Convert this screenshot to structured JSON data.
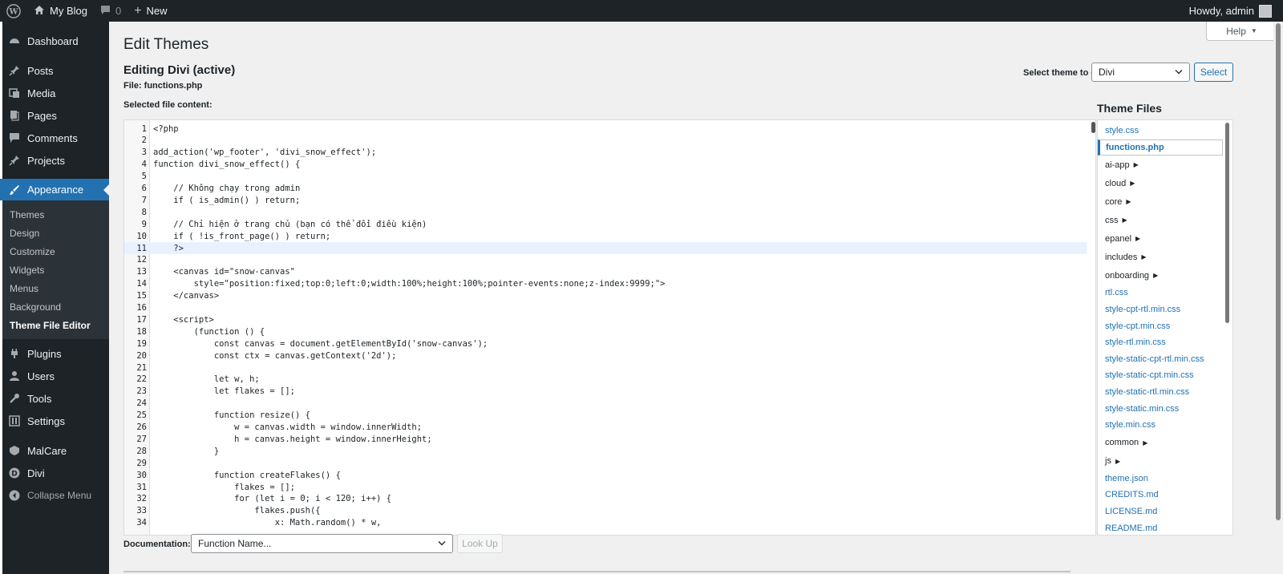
{
  "adminbar": {
    "site_name": "My Blog",
    "comments_count": "0",
    "new_label": "New",
    "howdy": "Howdy, admin"
  },
  "sidebar": {
    "items": [
      {
        "label": "Dashboard",
        "icon": "dashboard-icon"
      },
      {
        "label": "Posts",
        "icon": "pin-icon"
      },
      {
        "label": "Media",
        "icon": "media-icon"
      },
      {
        "label": "Pages",
        "icon": "page-icon"
      },
      {
        "label": "Comments",
        "icon": "comment-icon"
      },
      {
        "label": "Projects",
        "icon": "pin-icon"
      },
      {
        "label": "Appearance",
        "icon": "brush-icon"
      }
    ],
    "submenu": [
      "Themes",
      "Design",
      "Customize",
      "Widgets",
      "Menus",
      "Background",
      "Theme File Editor"
    ],
    "items2": [
      {
        "label": "Plugins",
        "icon": "plug-icon"
      },
      {
        "label": "Users",
        "icon": "user-icon"
      },
      {
        "label": "Tools",
        "icon": "wrench-icon"
      },
      {
        "label": "Settings",
        "icon": "settings-icon"
      },
      {
        "label": "MalCare",
        "icon": "malcare-icon"
      },
      {
        "label": "Divi",
        "icon": "divi-icon"
      }
    ],
    "collapse": "Collapse Menu"
  },
  "main": {
    "title": "Edit Themes",
    "help": "Help",
    "editing": "Editing Divi (active)",
    "file": "File: functions.php",
    "selected_content": "Selected file content:",
    "select_theme_label": "Select theme to edit:",
    "theme_selected": "Divi",
    "select_button": "Select",
    "theme_files_title": "Theme Files",
    "documentation_label": "Documentation:",
    "doc_placeholder": "Function Name...",
    "lookup_button": "Look Up"
  },
  "code_lines": [
    "<?php",
    "",
    "add_action('wp_footer', 'divi_snow_effect');",
    "function divi_snow_effect() {",
    "",
    "    // Không chạy trong admin",
    "    if ( is_admin() ) return;",
    "",
    "    // Chỉ hiện ở trang chủ (bạn có thể đổi điều kiện)",
    "    if ( !is_front_page() ) return;",
    "    ?>",
    "",
    "    <canvas id=\"snow-canvas\"",
    "        style=\"position:fixed;top:0;left:0;width:100%;height:100%;pointer-events:none;z-index:9999;\">",
    "    </canvas>",
    "",
    "    <script>",
    "        (function () {",
    "            const canvas = document.getElementById('snow-canvas');",
    "            const ctx = canvas.getContext('2d');",
    "",
    "            let w, h;",
    "            let flakes = [];",
    "",
    "            function resize() {",
    "                w = canvas.width = window.innerWidth;",
    "                h = canvas.height = window.innerHeight;",
    "            }",
    "",
    "            function createFlakes() {",
    "                flakes = [];",
    "                for (let i = 0; i < 120; i++) {",
    "                    flakes.push({",
    "                        x: Math.random() * w,"
  ],
  "active_line": 11,
  "theme_files": [
    {
      "name": "style.css",
      "type": "file"
    },
    {
      "name": "functions.php",
      "type": "file",
      "active": true
    },
    {
      "name": "ai-app",
      "type": "folder"
    },
    {
      "name": "cloud",
      "type": "folder"
    },
    {
      "name": "core",
      "type": "folder"
    },
    {
      "name": "css",
      "type": "folder"
    },
    {
      "name": "epanel",
      "type": "folder"
    },
    {
      "name": "includes",
      "type": "folder"
    },
    {
      "name": "onboarding",
      "type": "folder"
    },
    {
      "name": "rtl.css",
      "type": "file"
    },
    {
      "name": "style-cpt-rtl.min.css",
      "type": "file"
    },
    {
      "name": "style-cpt.min.css",
      "type": "file"
    },
    {
      "name": "style-rtl.min.css",
      "type": "file"
    },
    {
      "name": "style-static-cpt-rtl.min.css",
      "type": "file"
    },
    {
      "name": "style-static-cpt.min.css",
      "type": "file"
    },
    {
      "name": "style-static-rtl.min.css",
      "type": "file"
    },
    {
      "name": "style-static.min.css",
      "type": "file"
    },
    {
      "name": "style.min.css",
      "type": "file"
    },
    {
      "name": "common",
      "type": "folder"
    },
    {
      "name": "js",
      "type": "folder"
    },
    {
      "name": "theme.json",
      "type": "file"
    },
    {
      "name": "CREDITS.md",
      "type": "file"
    },
    {
      "name": "LICENSE.md",
      "type": "file"
    },
    {
      "name": "README.md",
      "type": "file"
    }
  ],
  "colors": {
    "accent": "#2271b1",
    "admin_bar": "#1d2327",
    "sidebar_sub": "#2c3338"
  }
}
